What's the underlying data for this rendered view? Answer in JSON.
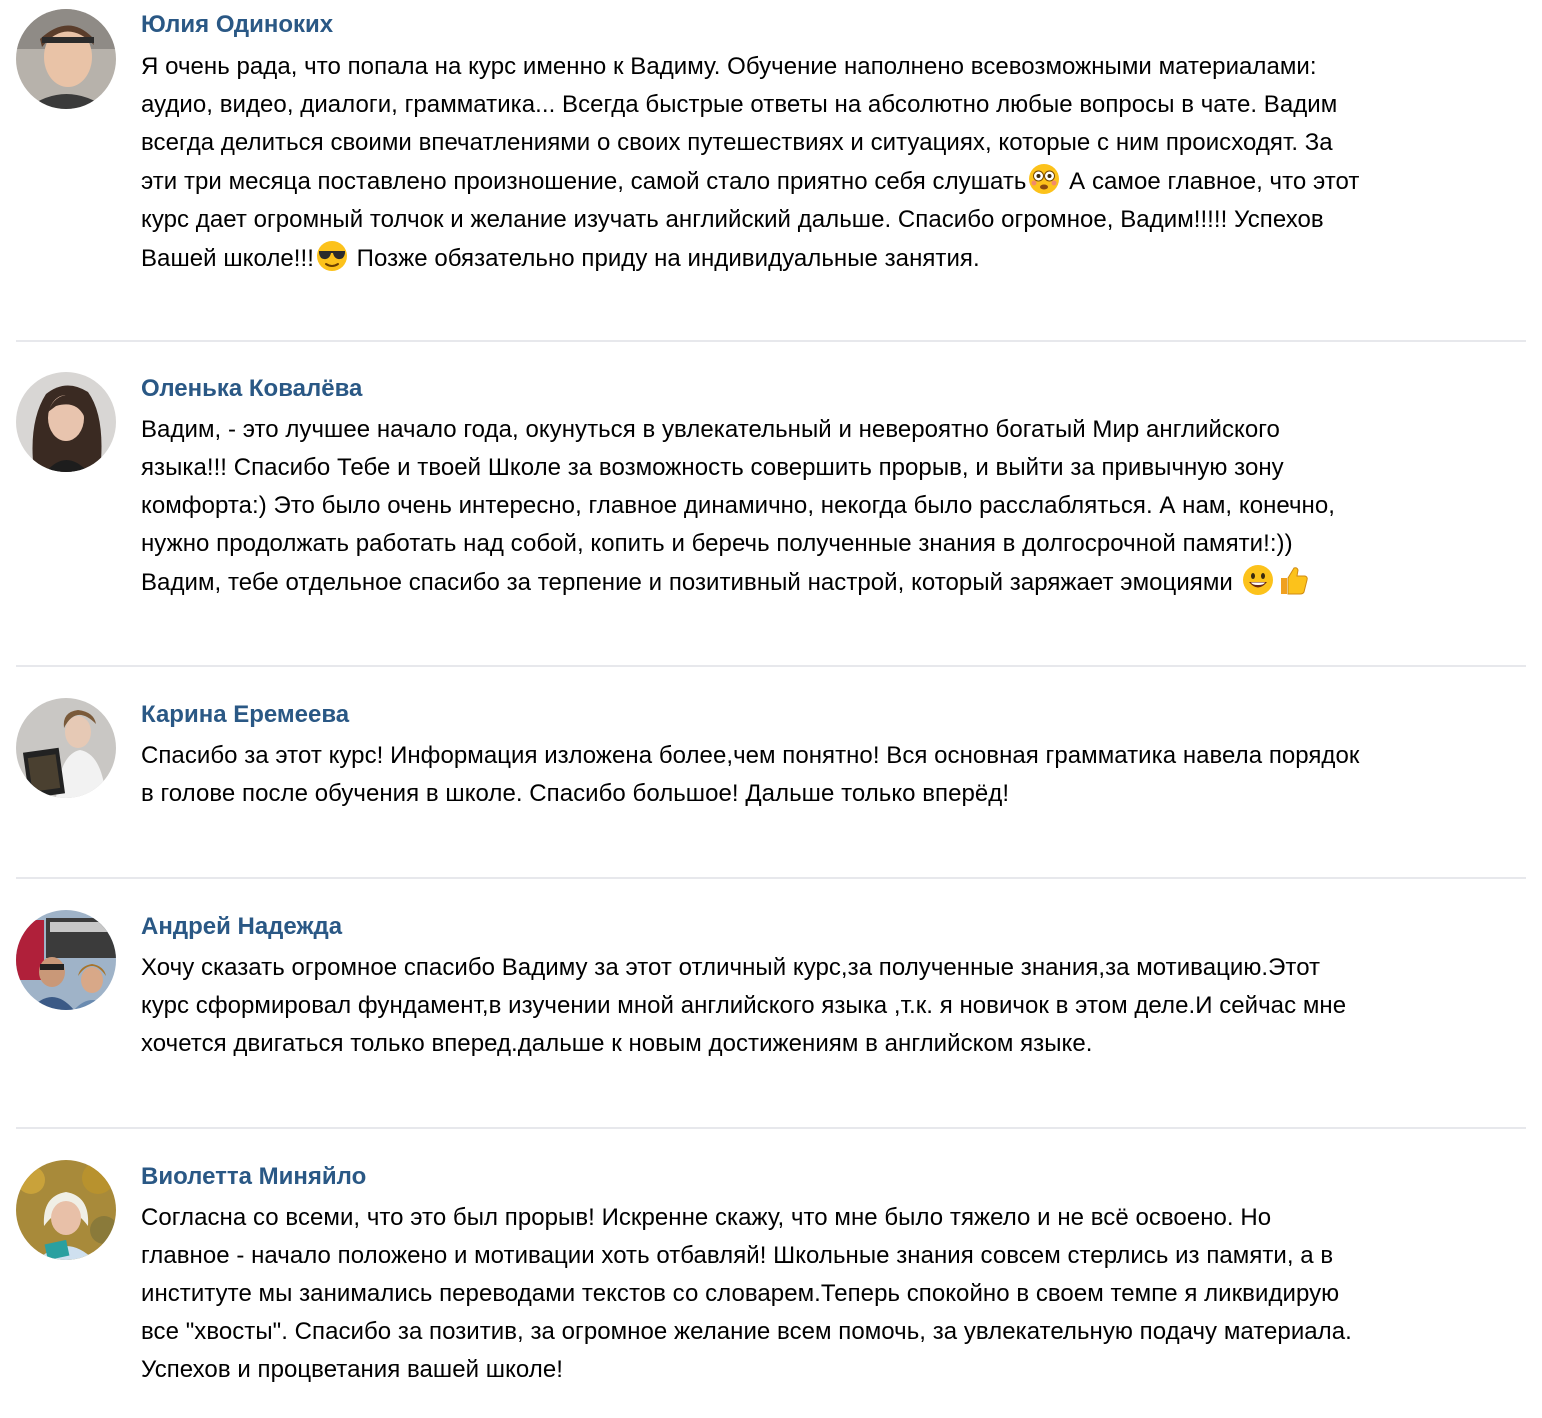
{
  "comments": [
    {
      "author": "Юлия Одиноких",
      "avatar": "avatar-woman-headband",
      "lines": [
        "Я очень рада, что попала на курс именно к Вадиму. Обучение наполнено всевозможными материалами:",
        "аудио, видео, диалоги, грамматика... Всегда быстрые ответы на абсолютно любые вопросы в чате. Вадим",
        "всегда делиться своими впечатлениями о своих путешествиях и ситуациях, которые с ним происходят. За",
        "эти три месяца поставлено произношение, самой стало приятно себя слушать",
        " А самое главное, что этот",
        "курс дает огромный толчок и желание изучать английский дальше. Спасибо огромное, Вадим!!!!! Успехов",
        "Вашей школе!!!",
        " Позже обязательно приду на индивидуальные занятия."
      ]
    },
    {
      "author": "Оленька Ковалёва",
      "avatar": "avatar-woman-dark-hair",
      "lines": [
        "Вадим, - это лучшее начало года, окунуться в увлекательный и невероятно богатый Мир английского",
        "языка!!! Спасибо Тебе и твоей Школе за возможность совершить прорыв, и выйти за привычную зону",
        "комфорта:) Это было очень интересно, главное динамично, некогда было расслабляться. А нам, конечно,",
        "нужно продолжать работать над собой, копить и беречь полученные знания в долгосрочной памяти!:))",
        "Вадим, тебе отдельное спасибо за терпение и позитивный настрой, который заряжает эмоциями "
      ]
    },
    {
      "author": "Карина Еремеева",
      "avatar": "avatar-woman-book",
      "lines": [
        "Спасибо за этот курс! Информация изложена более,чем понятно! Вся основная грамматика навела порядок",
        "в голове после обучения в школе. Спасибо большое! Дальше только вперёд!"
      ]
    },
    {
      "author": "Андрей Надежда",
      "avatar": "avatar-couple-outdoor",
      "lines": [
        "Хочу сказать огромное спасибо Вадиму за этот отличный курс,за полученные знания,за мотивацию.Этот",
        "курс сформировал фундамент,в изучении мной английского языка ,т.к. я новичок в этом деле.И сейчас мне",
        "хочется двигаться только вперед.дальше к новым достижениям в английском языке."
      ]
    },
    {
      "author": "Виолетта Миняйло",
      "avatar": "avatar-woman-autumn",
      "lines": [
        "Согласна со всеми, что это был прорыв! Искренне скажу, что мне было тяжело и не всё освоено. Но",
        "главное - начало положено и мотивации хоть отбавляй! Школьные знания совсем стерлись из памяти, а в",
        "институте мы занимались переводами текстов со словарем.Теперь спокойно в своем темпе я ликвидирую",
        "все \"хвосты\". Спасибо за позитив, за огромное желание всем помочь, за увлекательную подачу материала.",
        "Успехов и процветания вашей школе!"
      ]
    }
  ],
  "colors": {
    "author": "#2a5885",
    "text": "#000000",
    "divider": "#e7e8ec"
  },
  "emojis": {
    "c1_after_line4": "flushed-face-emoji",
    "c1_after_line7": "sunglasses-face-emoji",
    "c2_end_1": "grinning-face-emoji",
    "c2_end_2": "thumbs-up-emoji"
  }
}
